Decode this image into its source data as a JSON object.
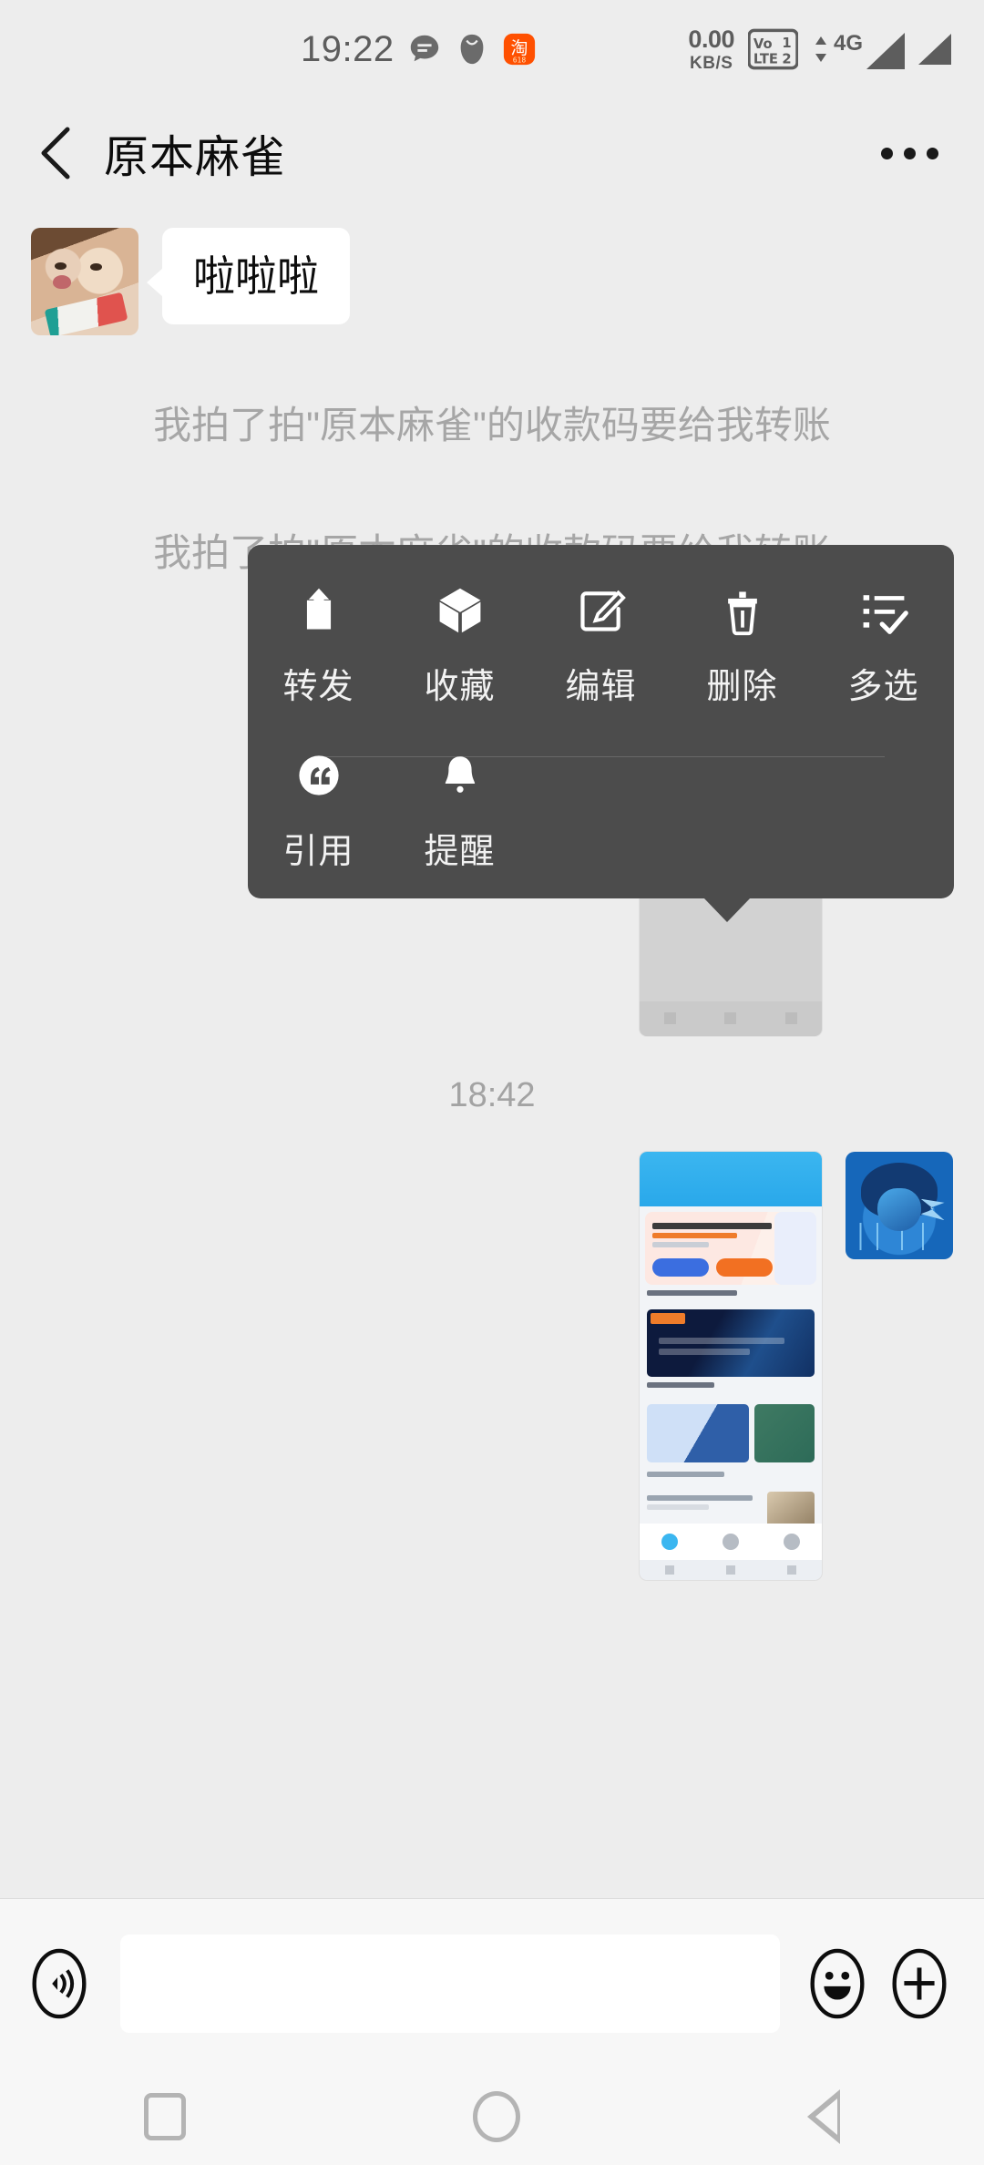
{
  "statusbar": {
    "time": "19:22",
    "icons_left": [
      "chat-bubble-icon",
      "mask-icon",
      "taobao-icon"
    ],
    "taobao_label": "淘",
    "taobao_sub": "618",
    "net_speed_value": "0.00",
    "net_speed_unit": "KB/S",
    "volte_label": "VoLTE",
    "sim1": "1",
    "sim2": "2",
    "network_type": "4G"
  },
  "header": {
    "back_icon": "chevron-left-icon",
    "title": "原本麻雀",
    "more_icon": "more-options-icon"
  },
  "chat": {
    "messages": [
      {
        "type": "text-in",
        "avatar": "cat-avatar",
        "text": "啦啦啦"
      },
      {
        "type": "system",
        "text": "我拍了拍\"原本麻雀\"的收款码要给我转账"
      },
      {
        "type": "system",
        "text": "我拍了拍\"原本麻雀\"的收款码要给我转账"
      },
      {
        "type": "image-out",
        "avatar": "pikachu-avatar",
        "image": "wechat-new-friends-screenshot"
      },
      {
        "type": "time",
        "text": "18:42"
      },
      {
        "type": "image-out",
        "avatar": "pikachu-avatar",
        "image": "parenting-app-screenshot"
      }
    ]
  },
  "context_menu": {
    "items_row1": [
      {
        "label": "转发",
        "icon": "share-forward-icon"
      },
      {
        "label": "收藏",
        "icon": "favorite-box-icon"
      },
      {
        "label": "编辑",
        "icon": "edit-pencil-icon"
      },
      {
        "label": "删除",
        "icon": "trash-delete-icon"
      },
      {
        "label": "多选",
        "icon": "multi-select-icon"
      }
    ],
    "items_row2": [
      {
        "label": "引用",
        "icon": "quote-icon"
      },
      {
        "label": "提醒",
        "icon": "bell-reminder-icon"
      }
    ]
  },
  "input_bar": {
    "voice_icon": "voice-input-icon",
    "input_value": "",
    "input_placeholder": "",
    "emoji_icon": "emoji-smiley-icon",
    "plus_icon": "add-plus-icon"
  },
  "system_nav": {
    "recents_icon": "recents-square-icon",
    "home_icon": "home-circle-icon",
    "back_icon": "back-triangle-icon"
  },
  "colors": {
    "chat_bg": "#ededed",
    "bubble_in": "#ffffff",
    "menu_bg": "#4c4c4c",
    "system_text": "#a6a6a6",
    "accent_orange": "#ff5000",
    "avatar_blue": "#1667ba"
  }
}
